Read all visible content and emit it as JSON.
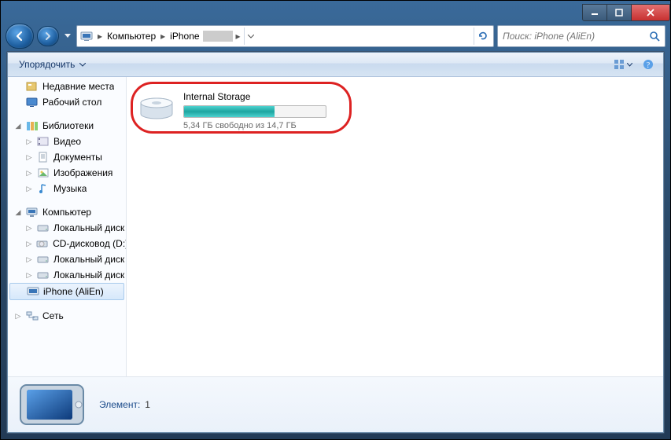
{
  "titlebar": {},
  "nav": {
    "crumbs": [
      "Компьютер",
      "iPhone"
    ],
    "search_placeholder": "Поиск: iPhone (AliEn)"
  },
  "toolbar": {
    "organize": "Упорядочить"
  },
  "tree": {
    "recent": "Недавние места",
    "desktop": "Рабочий стол",
    "libraries": "Библиотеки",
    "video": "Видео",
    "documents": "Документы",
    "pictures": "Изображения",
    "music": "Музыка",
    "computer": "Компьютер",
    "localdisk": "Локальный диск",
    "cddrive": "CD-дисковод (D:)",
    "localdisk2": "Локальный диск",
    "localdisk3": "Локальный диск",
    "iphone": "iPhone (AliEn)",
    "network": "Сеть"
  },
  "drive": {
    "name": "Internal Storage",
    "free_text": "5,34 ГБ свободно из 14,7 ГБ",
    "used_percent": 64
  },
  "details": {
    "label": "Элемент:",
    "count": "1"
  }
}
